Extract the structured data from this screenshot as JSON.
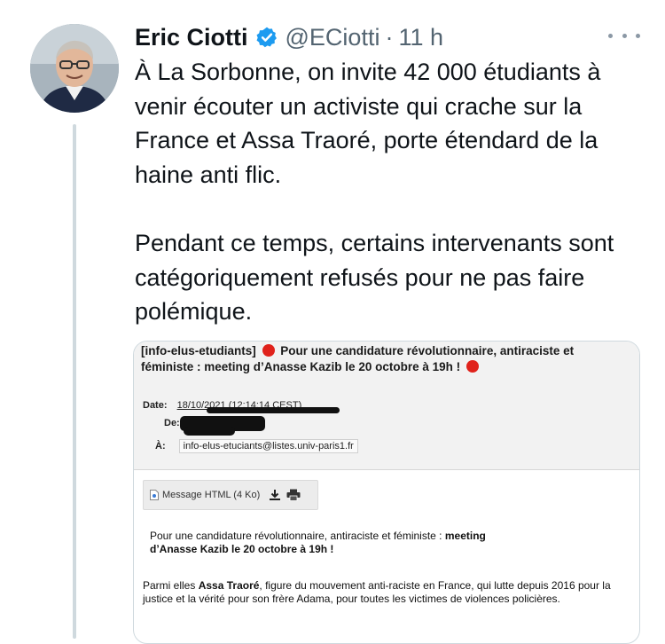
{
  "author": {
    "name": "Eric Ciotti",
    "handle": "@ECiotti",
    "separator": "·",
    "time": "11 h",
    "avatar_icon": "user-avatar",
    "verified_icon": "verified-badge-icon",
    "verified_color": "#1d9bf0"
  },
  "tweet": {
    "paragraph1": "À La Sorbonne, on invite 42 000 étudiants à venir écouter un activiste qui crache sur la France et Assa Traoré, porte étendard de la haine anti flic.",
    "paragraph2": "Pendant ce temps, certains intervenants sont catégoriquement refusés pour ne pas faire polémique."
  },
  "email": {
    "subject_part1": "[info-elus-etudiants]",
    "subject_part2": "Pour une candidature révolutionnaire, antiraciste et féministe : meeting d’Anasse Kazib le 20 octobre à 19h !",
    "date_label": "Date:",
    "date_value": "18/10/2021 (12:14:14",
    "date_tz": "CEST)",
    "from_label": "De:",
    "to_label": "À:",
    "to_value": "info-elus-etuciants@listes.univ-paris1.fr",
    "attachment": "Message HTML (4 Ko)",
    "body1_regular": "Pour une candidature révolutionnaire, antiraciste et féministe :",
    "body1_bold_a": "meeting",
    "body1_bold_b": "d’Anasse Kazib le 20 octobre à 19h !",
    "body2_lead": "Parmi elles",
    "body2_bold": "Assa Traoré",
    "body2_rest": ", figure du mouvement anti-raciste en France, qui lutte depuis 2016 pour la justice et la vérité pour son frère Adama, pour toutes les victimes de violences policières.",
    "red_dot_color": "#e0221b"
  }
}
